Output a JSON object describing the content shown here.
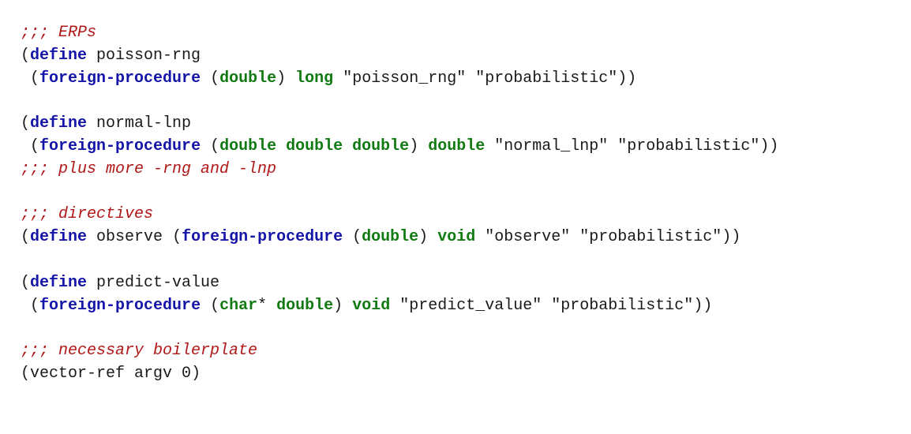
{
  "code": {
    "lines": [
      [
        [
          "comment",
          ";;; ERPs"
        ]
      ],
      [
        [
          "paren",
          "("
        ],
        [
          "keyword",
          "define"
        ],
        [
          "plain",
          " poisson-rng"
        ]
      ],
      [
        [
          "plain",
          " "
        ],
        [
          "paren",
          "("
        ],
        [
          "keyword",
          "foreign-procedure"
        ],
        [
          "plain",
          " "
        ],
        [
          "paren",
          "("
        ],
        [
          "type",
          "double"
        ],
        [
          "paren",
          ")"
        ],
        [
          "plain",
          " "
        ],
        [
          "type",
          "long"
        ],
        [
          "plain",
          " "
        ],
        [
          "string",
          "\"poisson_rng\""
        ],
        [
          "plain",
          " "
        ],
        [
          "string",
          "\"probabilistic\""
        ],
        [
          "paren",
          "))"
        ]
      ],
      [],
      [
        [
          "paren",
          "("
        ],
        [
          "keyword",
          "define"
        ],
        [
          "plain",
          " normal-lnp"
        ]
      ],
      [
        [
          "plain",
          " "
        ],
        [
          "paren",
          "("
        ],
        [
          "keyword",
          "foreign-procedure"
        ],
        [
          "plain",
          " "
        ],
        [
          "paren",
          "("
        ],
        [
          "type",
          "double"
        ],
        [
          "plain",
          " "
        ],
        [
          "type",
          "double"
        ],
        [
          "plain",
          " "
        ],
        [
          "type",
          "double"
        ],
        [
          "paren",
          ")"
        ],
        [
          "plain",
          " "
        ],
        [
          "type",
          "double"
        ],
        [
          "plain",
          " "
        ],
        [
          "string",
          "\"normal_lnp\""
        ],
        [
          "plain",
          " "
        ],
        [
          "string",
          "\"probabilistic\""
        ],
        [
          "paren",
          "))"
        ]
      ],
      [
        [
          "comment",
          ";;; plus more -rng and -lnp"
        ]
      ],
      [],
      [
        [
          "comment",
          ";;; directives"
        ]
      ],
      [
        [
          "paren",
          "("
        ],
        [
          "keyword",
          "define"
        ],
        [
          "plain",
          " observe "
        ],
        [
          "paren",
          "("
        ],
        [
          "keyword",
          "foreign-procedure"
        ],
        [
          "plain",
          " "
        ],
        [
          "paren",
          "("
        ],
        [
          "type",
          "double"
        ],
        [
          "paren",
          ")"
        ],
        [
          "plain",
          " "
        ],
        [
          "type",
          "void"
        ],
        [
          "plain",
          " "
        ],
        [
          "string",
          "\"observe\""
        ],
        [
          "plain",
          " "
        ],
        [
          "string",
          "\"probabilistic\""
        ],
        [
          "paren",
          "))"
        ]
      ],
      [],
      [
        [
          "paren",
          "("
        ],
        [
          "keyword",
          "define"
        ],
        [
          "plain",
          " predict-value"
        ]
      ],
      [
        [
          "plain",
          " "
        ],
        [
          "paren",
          "("
        ],
        [
          "keyword",
          "foreign-procedure"
        ],
        [
          "plain",
          " "
        ],
        [
          "paren",
          "("
        ],
        [
          "type",
          "char"
        ],
        [
          "plain",
          "*"
        ],
        [
          "plain",
          " "
        ],
        [
          "type",
          "double"
        ],
        [
          "paren",
          ")"
        ],
        [
          "plain",
          " "
        ],
        [
          "type",
          "void"
        ],
        [
          "plain",
          " "
        ],
        [
          "string",
          "\"predict_value\""
        ],
        [
          "plain",
          " "
        ],
        [
          "string",
          "\"probabilistic\""
        ],
        [
          "paren",
          "))"
        ]
      ],
      [],
      [
        [
          "comment",
          ";;; necessary boilerplate"
        ]
      ],
      [
        [
          "paren",
          "("
        ],
        [
          "plain",
          "vector-ref argv 0"
        ],
        [
          "paren",
          ")"
        ]
      ]
    ]
  },
  "colors": {
    "keyword": "#1515a8",
    "type": "#127a12",
    "comment": "#b01818",
    "text": "#1a1a1a",
    "background": "#ffffff"
  }
}
